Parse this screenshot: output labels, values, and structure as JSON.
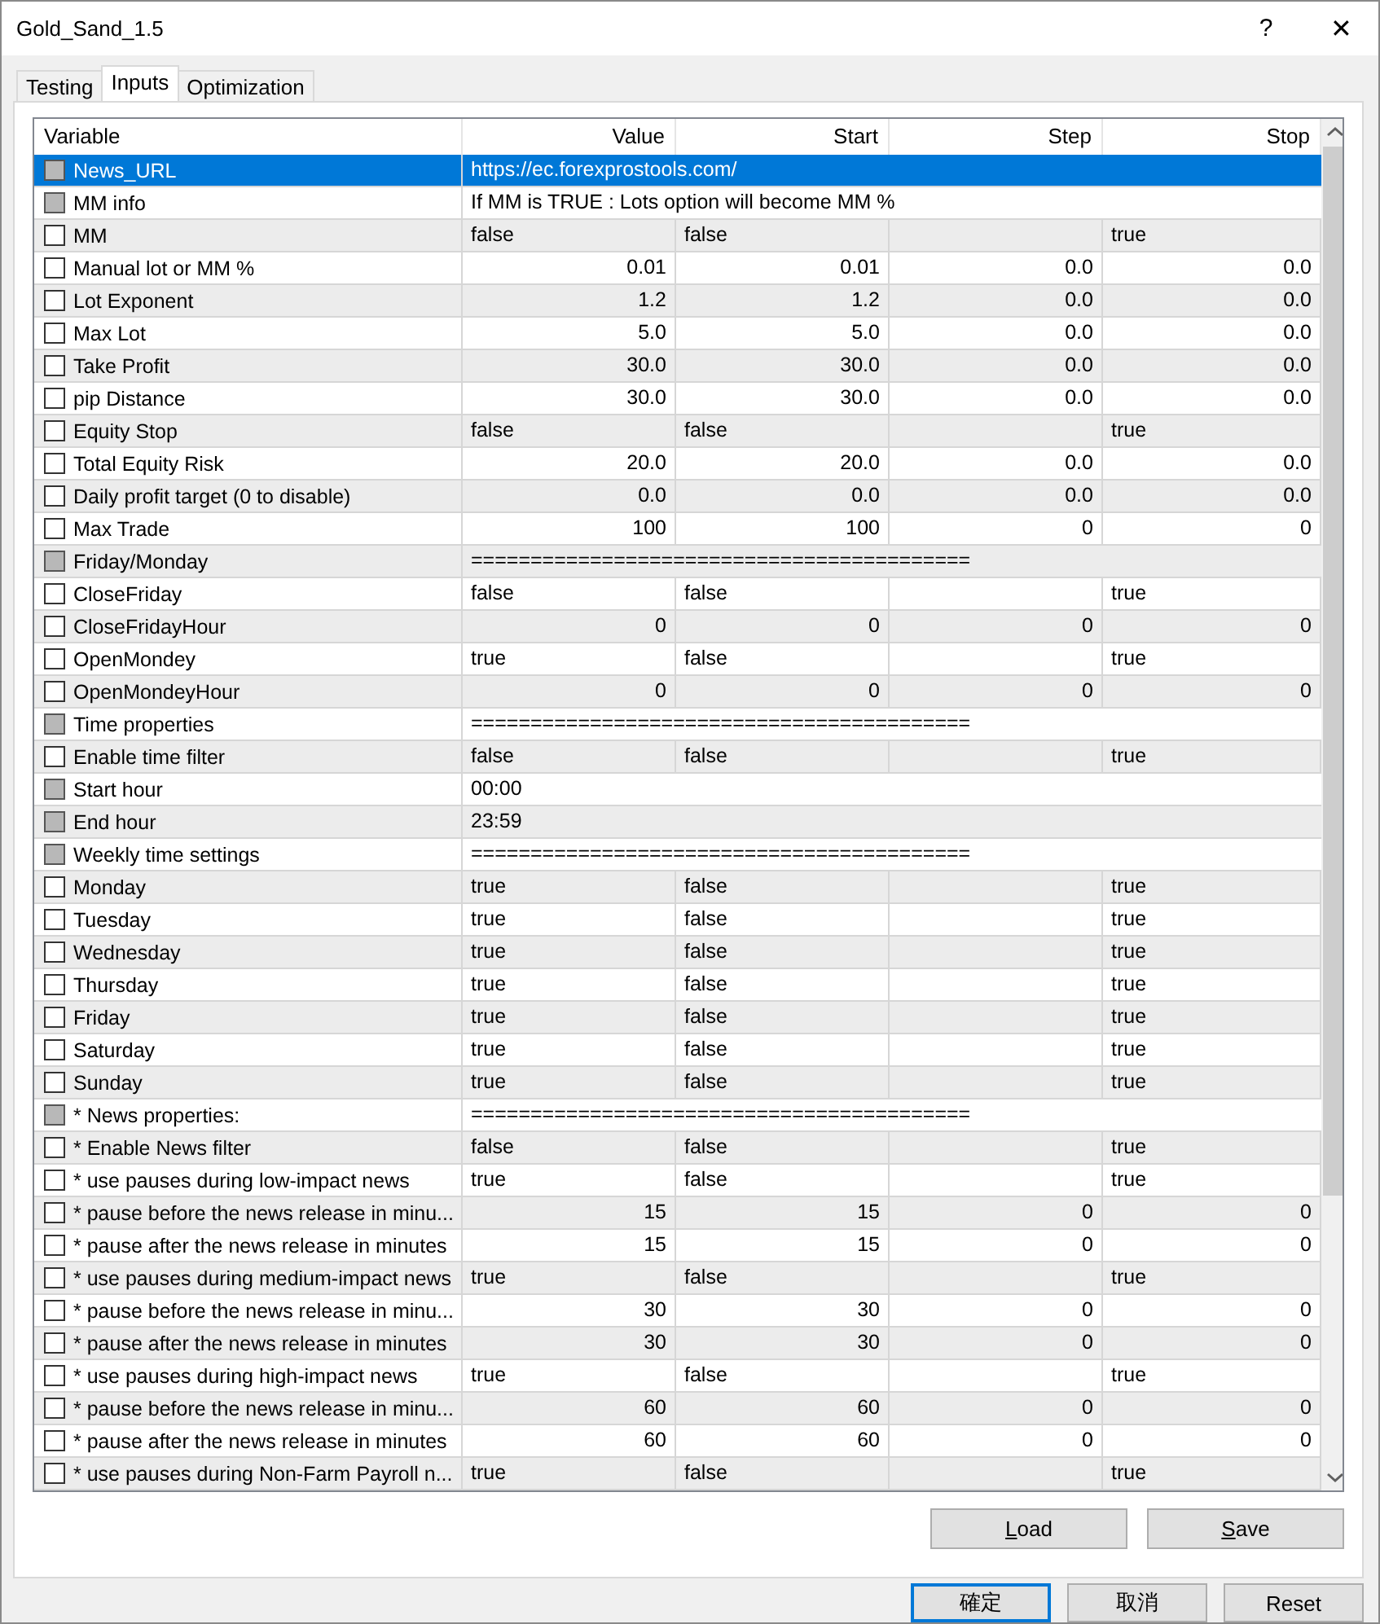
{
  "window": {
    "title": "Gold_Sand_1.5",
    "help": "?",
    "close": "✕"
  },
  "tabs": [
    {
      "label": "Testing",
      "selected": false
    },
    {
      "label": "Inputs",
      "selected": true
    },
    {
      "label": "Optimization",
      "selected": false
    }
  ],
  "table": {
    "columns": [
      "Variable",
      "Value",
      "Start",
      "Step",
      "Stop"
    ],
    "rows": [
      {
        "variable": "News_URL",
        "disabled": true,
        "checked": false,
        "selected": true,
        "kind": "note",
        "value": "https://ec.forexprostools.com/"
      },
      {
        "variable": "MM info",
        "disabled": true,
        "checked": false,
        "selected": false,
        "kind": "note",
        "value": "If MM is TRUE : Lots option will become MM %"
      },
      {
        "variable": "MM",
        "disabled": false,
        "checked": false,
        "selected": false,
        "kind": "bool",
        "value": "false",
        "start": "false",
        "stop": "true"
      },
      {
        "variable": "Manual lot or MM %",
        "disabled": false,
        "checked": false,
        "selected": false,
        "kind": "number",
        "value": "0.01",
        "start": "0.01",
        "step": "0.0",
        "stop": "0.0"
      },
      {
        "variable": "Lot Exponent",
        "disabled": false,
        "checked": false,
        "selected": false,
        "kind": "number",
        "value": "1.2",
        "start": "1.2",
        "step": "0.0",
        "stop": "0.0"
      },
      {
        "variable": "Max Lot",
        "disabled": false,
        "checked": false,
        "selected": false,
        "kind": "number",
        "value": "5.0",
        "start": "5.0",
        "step": "0.0",
        "stop": "0.0"
      },
      {
        "variable": "Take Profit",
        "disabled": false,
        "checked": false,
        "selected": false,
        "kind": "number",
        "value": "30.0",
        "start": "30.0",
        "step": "0.0",
        "stop": "0.0"
      },
      {
        "variable": "pip Distance",
        "disabled": false,
        "checked": false,
        "selected": false,
        "kind": "number",
        "value": "30.0",
        "start": "30.0",
        "step": "0.0",
        "stop": "0.0"
      },
      {
        "variable": "Equity Stop",
        "disabled": false,
        "checked": false,
        "selected": false,
        "kind": "bool",
        "value": "false",
        "start": "false",
        "stop": "true"
      },
      {
        "variable": "Total Equity Risk",
        "disabled": false,
        "checked": false,
        "selected": false,
        "kind": "number",
        "value": "20.0",
        "start": "20.0",
        "step": "0.0",
        "stop": "0.0"
      },
      {
        "variable": "Daily profit target (0 to disable)",
        "disabled": false,
        "checked": false,
        "selected": false,
        "kind": "number",
        "value": "0.0",
        "start": "0.0",
        "step": "0.0",
        "stop": "0.0"
      },
      {
        "variable": "Max Trade",
        "disabled": false,
        "checked": false,
        "selected": false,
        "kind": "number",
        "value": "100",
        "start": "100",
        "step": "0",
        "stop": "0"
      },
      {
        "variable": "Friday/Monday",
        "disabled": true,
        "checked": false,
        "selected": false,
        "kind": "note",
        "value": "=========================================="
      },
      {
        "variable": "CloseFriday",
        "disabled": false,
        "checked": false,
        "selected": false,
        "kind": "bool",
        "value": "false",
        "start": "false",
        "stop": "true"
      },
      {
        "variable": "CloseFridayHour",
        "disabled": false,
        "checked": false,
        "selected": false,
        "kind": "number",
        "value": "0",
        "start": "0",
        "step": "0",
        "stop": "0"
      },
      {
        "variable": "OpenMondey",
        "disabled": false,
        "checked": false,
        "selected": false,
        "kind": "bool",
        "value": "true",
        "start": "false",
        "stop": "true"
      },
      {
        "variable": "OpenMondeyHour",
        "disabled": false,
        "checked": false,
        "selected": false,
        "kind": "number",
        "value": "0",
        "start": "0",
        "step": "0",
        "stop": "0"
      },
      {
        "variable": "Time properties",
        "disabled": true,
        "checked": false,
        "selected": false,
        "kind": "note",
        "value": "=========================================="
      },
      {
        "variable": "Enable time filter",
        "disabled": false,
        "checked": false,
        "selected": false,
        "kind": "bool",
        "value": "false",
        "start": "false",
        "stop": "true"
      },
      {
        "variable": "Start hour",
        "disabled": true,
        "checked": false,
        "selected": false,
        "kind": "note",
        "value": "00:00"
      },
      {
        "variable": "End hour",
        "disabled": true,
        "checked": false,
        "selected": false,
        "kind": "note",
        "value": "23:59"
      },
      {
        "variable": "Weekly time settings",
        "disabled": true,
        "checked": false,
        "selected": false,
        "kind": "note",
        "value": "=========================================="
      },
      {
        "variable": "Monday",
        "disabled": false,
        "checked": false,
        "selected": false,
        "kind": "bool",
        "value": "true",
        "start": "false",
        "stop": "true"
      },
      {
        "variable": "Tuesday",
        "disabled": false,
        "checked": false,
        "selected": false,
        "kind": "bool",
        "value": "true",
        "start": "false",
        "stop": "true"
      },
      {
        "variable": "Wednesday",
        "disabled": false,
        "checked": false,
        "selected": false,
        "kind": "bool",
        "value": "true",
        "start": "false",
        "stop": "true"
      },
      {
        "variable": "Thursday",
        "disabled": false,
        "checked": false,
        "selected": false,
        "kind": "bool",
        "value": "true",
        "start": "false",
        "stop": "true"
      },
      {
        "variable": "Friday",
        "disabled": false,
        "checked": false,
        "selected": false,
        "kind": "bool",
        "value": "true",
        "start": "false",
        "stop": "true"
      },
      {
        "variable": "Saturday",
        "disabled": false,
        "checked": false,
        "selected": false,
        "kind": "bool",
        "value": "true",
        "start": "false",
        "stop": "true"
      },
      {
        "variable": "Sunday",
        "disabled": false,
        "checked": false,
        "selected": false,
        "kind": "bool",
        "value": "true",
        "start": "false",
        "stop": "true"
      },
      {
        "variable": "*  News properties:",
        "disabled": true,
        "checked": false,
        "selected": false,
        "kind": "note",
        "value": "=========================================="
      },
      {
        "variable": "* Enable News filter",
        "disabled": false,
        "checked": false,
        "selected": false,
        "kind": "bool",
        "value": "false",
        "start": "false",
        "stop": "true"
      },
      {
        "variable": "* use pauses during low-impact news",
        "disabled": false,
        "checked": false,
        "selected": false,
        "kind": "bool",
        "value": "true",
        "start": "false",
        "stop": "true"
      },
      {
        "variable": "* pause before the news release in minu...",
        "disabled": false,
        "checked": false,
        "selected": false,
        "kind": "number",
        "value": "15",
        "start": "15",
        "step": "0",
        "stop": "0"
      },
      {
        "variable": "* pause after the news release in minutes",
        "disabled": false,
        "checked": false,
        "selected": false,
        "kind": "number",
        "value": "15",
        "start": "15",
        "step": "0",
        "stop": "0"
      },
      {
        "variable": "* use pauses during medium-impact news",
        "disabled": false,
        "checked": false,
        "selected": false,
        "kind": "bool",
        "value": "true",
        "start": "false",
        "stop": "true"
      },
      {
        "variable": "* pause before the news release in minu...",
        "disabled": false,
        "checked": false,
        "selected": false,
        "kind": "number",
        "value": "30",
        "start": "30",
        "step": "0",
        "stop": "0"
      },
      {
        "variable": "* pause after the news release in minutes",
        "disabled": false,
        "checked": false,
        "selected": false,
        "kind": "number",
        "value": "30",
        "start": "30",
        "step": "0",
        "stop": "0"
      },
      {
        "variable": "* use pauses during high-impact news",
        "disabled": false,
        "checked": false,
        "selected": false,
        "kind": "bool",
        "value": "true",
        "start": "false",
        "stop": "true"
      },
      {
        "variable": "* pause before the news release in minu...",
        "disabled": false,
        "checked": false,
        "selected": false,
        "kind": "number",
        "value": "60",
        "start": "60",
        "step": "0",
        "stop": "0"
      },
      {
        "variable": "* pause after the news release in minutes",
        "disabled": false,
        "checked": false,
        "selected": false,
        "kind": "number",
        "value": "60",
        "start": "60",
        "step": "0",
        "stop": "0"
      },
      {
        "variable": "* use pauses during Non-Farm Payroll n...",
        "disabled": false,
        "checked": false,
        "selected": false,
        "kind": "bool",
        "value": "true",
        "start": "false",
        "stop": "true"
      }
    ]
  },
  "panel_buttons": [
    "Load",
    "Save"
  ],
  "dialog_buttons": [
    {
      "label": "確定",
      "default": true
    },
    {
      "label": "取消",
      "default": false
    },
    {
      "label": "Reset",
      "default": false
    }
  ]
}
